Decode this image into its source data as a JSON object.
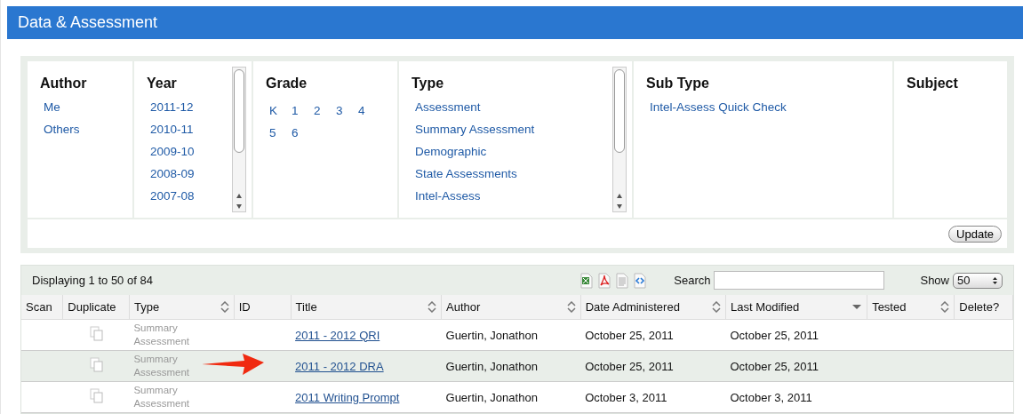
{
  "header": {
    "title": "Data & Assessment"
  },
  "filters": [
    {
      "heading": "Author",
      "kind": "list",
      "scrollable": false,
      "items": [
        "Me",
        "Others"
      ]
    },
    {
      "heading": "Year",
      "kind": "list",
      "scrollable": true,
      "items": [
        "2011-12",
        "2010-11",
        "2009-10",
        "2008-09",
        "2007-08"
      ]
    },
    {
      "heading": "Grade",
      "kind": "grid",
      "scrollable": false,
      "items": [
        "K",
        "1",
        "2",
        "3",
        "4",
        "5",
        "6"
      ]
    },
    {
      "heading": "Type",
      "kind": "list",
      "scrollable": true,
      "items": [
        "Assessment",
        "Summary Assessment",
        "Demographic",
        "State Assessments",
        "Intel-Assess"
      ]
    },
    {
      "heading": "Sub Type",
      "kind": "list",
      "scrollable": false,
      "items": [
        "Intel-Assess Quick Check"
      ]
    },
    {
      "heading": "Subject",
      "kind": "list",
      "scrollable": false
    }
  ],
  "update_button": "Update",
  "table": {
    "summary": "Displaying 1 to 50 of 84",
    "search": {
      "label": "Search"
    },
    "show": {
      "label": "Show",
      "value": "50"
    },
    "columns": [
      {
        "label": "Scan",
        "kind": "plain"
      },
      {
        "label": "Duplicate",
        "kind": "plain"
      },
      {
        "label": "Type",
        "kind": "sortable"
      },
      {
        "label": "ID",
        "kind": "plain"
      },
      {
        "label": "Title",
        "kind": "sortable"
      },
      {
        "label": "Author",
        "kind": "sortable"
      },
      {
        "label": "Date Administered",
        "kind": "sortable"
      },
      {
        "label": "Last Modified",
        "kind": "descending"
      },
      {
        "label": "Tested",
        "kind": "sortable"
      },
      {
        "label": "Delete?",
        "kind": "plain"
      }
    ],
    "rows": [
      {
        "selected": false,
        "type": "Summary Assessment",
        "title": "2011 - 2012 QRI",
        "author": "Guertin, Jonathon",
        "date_administered": "October 25, 2011",
        "last_modified": "October 25, 2011"
      },
      {
        "selected": true,
        "type": "Summary Assessment",
        "title": "2011 - 2012 DRA",
        "author": "Guertin, Jonathon",
        "date_administered": "October 25, 2011",
        "last_modified": "October 25, 2011"
      },
      {
        "selected": false,
        "type": "Summary Assessment",
        "title": "2011 Writing Prompt",
        "author": "Guertin, Jonathon",
        "date_administered": "October 3, 2011",
        "last_modified": "October 3, 2011"
      }
    ]
  }
}
